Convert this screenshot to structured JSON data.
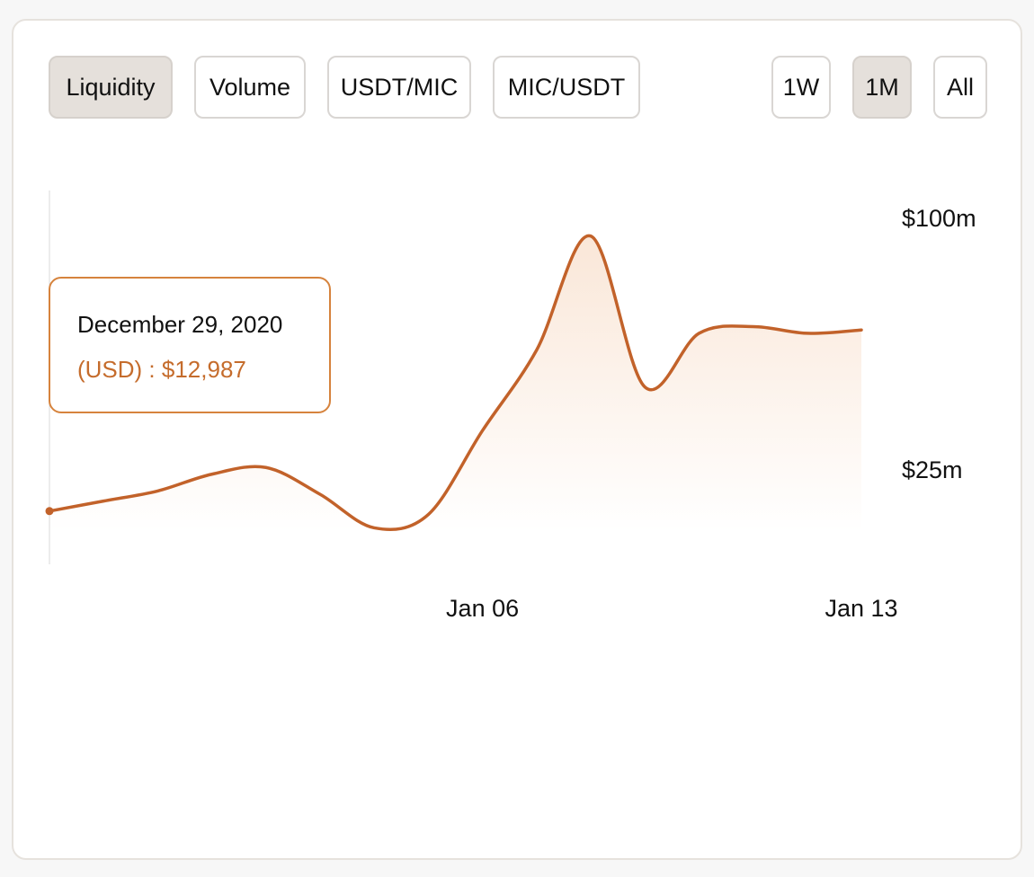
{
  "tabs": {
    "metric": [
      {
        "label": "Liquidity",
        "active": true
      },
      {
        "label": "Volume",
        "active": false
      },
      {
        "label": "USDT/MIC",
        "active": false
      },
      {
        "label": "MIC/USDT",
        "active": false
      }
    ],
    "range": [
      {
        "label": "1W",
        "active": false
      },
      {
        "label": "1M",
        "active": true
      },
      {
        "label": "All",
        "active": false
      }
    ]
  },
  "tooltip": {
    "date": "December 29, 2020",
    "value": "(USD) : $12,987"
  },
  "colors": {
    "line": "#c2622a",
    "fill_top": "#f3c9a8",
    "tooltip_border": "#d6833d",
    "tooltip_value": "#c56c2c",
    "active_tab_bg": "#e5e0db"
  },
  "chart_data": {
    "type": "area",
    "x": [
      "2020-12-29",
      "2020-12-30",
      "2020-12-31",
      "2021-01-01",
      "2021-01-02",
      "2021-01-03",
      "2021-01-04",
      "2021-01-05",
      "2021-01-06",
      "2021-01-07",
      "2021-01-08",
      "2021-01-09",
      "2021-01-10",
      "2021-01-11",
      "2021-01-12",
      "2021-01-13"
    ],
    "values": [
      13,
      16,
      19,
      24,
      26,
      18,
      8,
      12,
      37,
      61,
      95,
      50,
      66,
      68,
      66,
      67
    ],
    "unit": "million USD",
    "y_ticks": [
      {
        "value": 100,
        "label": "$100m"
      },
      {
        "value": 25,
        "label": "$25m"
      }
    ],
    "x_ticks": [
      {
        "value": "2021-01-06",
        "label": "Jan 06"
      },
      {
        "value": "2021-01-13",
        "label": "Jan 13"
      }
    ],
    "highlighted_point": "2020-12-29",
    "grid": false,
    "legend": "none"
  }
}
